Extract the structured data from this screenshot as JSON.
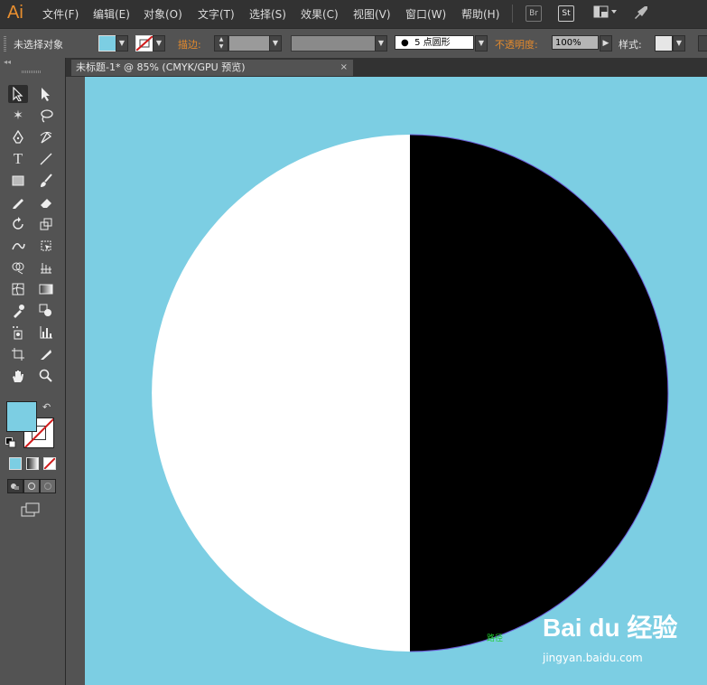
{
  "app": {
    "logo": "Ai"
  },
  "menu": {
    "items": [
      "文件(F)",
      "编辑(E)",
      "对象(O)",
      "文字(T)",
      "选择(S)",
      "效果(C)",
      "视图(V)",
      "窗口(W)",
      "帮助(H)"
    ],
    "br_label": "Br",
    "st_label": "St"
  },
  "control_bar": {
    "selection_status": "未选择对象",
    "fill_color": "#7ccee3",
    "stroke_label": "描边",
    "brush_label": "5 点圆形",
    "opacity_label": "不透明度",
    "opacity_value": "100%",
    "style_label": "样式"
  },
  "document": {
    "tab_title": "未标题-1* @ 85% (CMYK/GPU 预览)",
    "close_glyph": "×"
  },
  "canvas": {
    "background": "#7ccee3",
    "path_label": "路径"
  },
  "artwork": {
    "left_half_color": "#ffffff",
    "right_half_color": "#000000"
  },
  "watermark": {
    "brand": "Bai du 经验",
    "url": "jingyan.baidu.com"
  }
}
